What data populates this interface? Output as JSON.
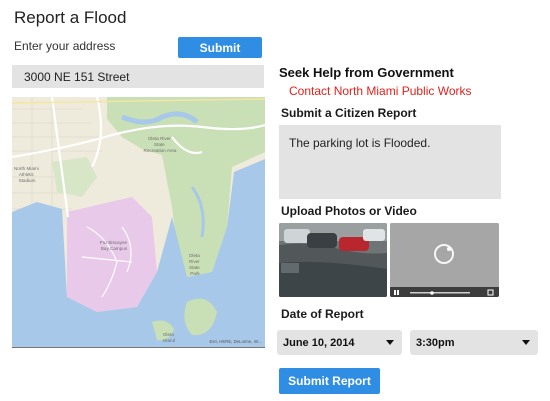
{
  "page": {
    "title": "Report a Flood",
    "address_label": "Enter your address",
    "address_submit": "Submit",
    "address_value": "3000 NE 151 Street"
  },
  "map": {
    "labels": {
      "north_miami_stadium": [
        "North Miami",
        "Athletic",
        "Stadium"
      ],
      "oleta_recreation": [
        "Oleta River",
        "State",
        "Recreation Area"
      ],
      "fiu_campus": [
        "FIU Biscayne",
        "Bay Campus"
      ],
      "oleta_park": [
        "Oleta",
        "River",
        "State",
        "Park"
      ],
      "oleta_island": [
        "Oleta",
        "Island"
      ]
    },
    "attribution": "Esri, HERE, DeLorme, Int...",
    "colors": {
      "land": "#eeeadc",
      "water": "#a7c8e8",
      "park": "#c9dfb6",
      "campus": "#e9c9ea",
      "road": "#ffffff"
    }
  },
  "help": {
    "heading": "Seek Help from Government",
    "contact": "Contact North Miami Public Works",
    "contact_color": "#e3201b"
  },
  "report": {
    "heading": "Submit a Citizen Report",
    "text": "The parking lot is Flooded."
  },
  "upload": {
    "heading": "Upload Photos or Video",
    "video_icons": [
      "play-icon",
      "loading-spinner-icon",
      "fullscreen-icon"
    ]
  },
  "date": {
    "heading": "Date of Report",
    "date_value": "June 10, 2014",
    "time_value": "3:30pm"
  },
  "submit_report": "Submit Report",
  "accent_color": "#2f8de4"
}
